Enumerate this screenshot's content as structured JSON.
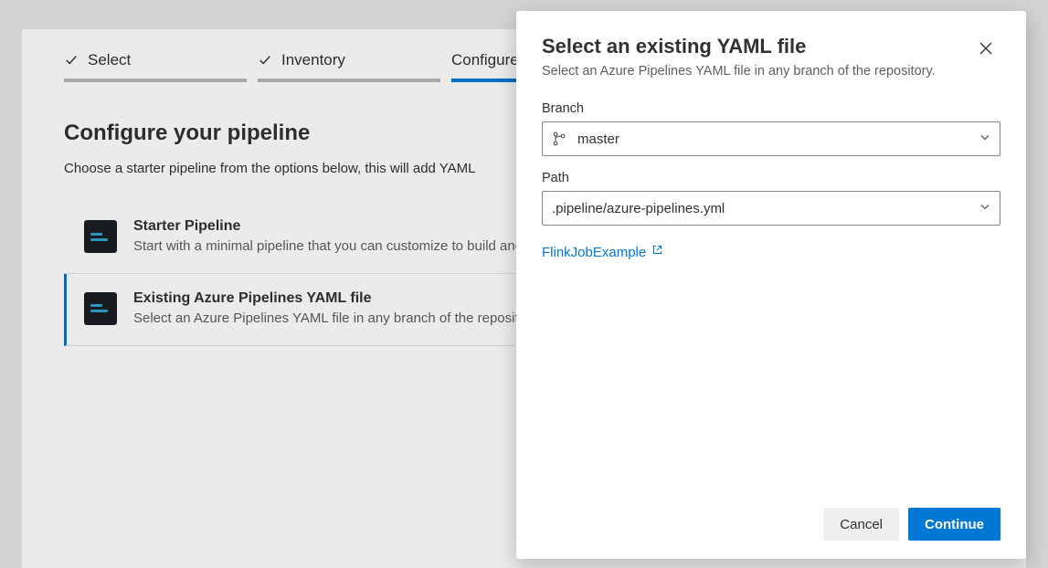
{
  "wizard": {
    "steps": [
      {
        "label": "Select",
        "done": true
      },
      {
        "label": "Inventory",
        "done": true
      },
      {
        "label": "Configure",
        "done": false,
        "active": true
      }
    ]
  },
  "page": {
    "heading": "Configure your pipeline",
    "subtext": "Choose a starter pipeline from the options below, this will add YAML"
  },
  "options": [
    {
      "title": "Starter Pipeline",
      "desc": "Start with a minimal pipeline that you can customize to build and deploy your code."
    },
    {
      "title": "Existing Azure Pipelines YAML file",
      "desc": "Select an Azure Pipelines YAML file in any branch of the repository."
    }
  ],
  "dialog": {
    "title": "Select an existing YAML file",
    "subtitle": "Select an Azure Pipelines YAML file in any branch of the repository.",
    "branch_label": "Branch",
    "branch_value": "master",
    "path_label": "Path",
    "path_value": ".pipeline/azure-pipelines.yml",
    "repo_link": "FlinkJobExample",
    "cancel_label": "Cancel",
    "continue_label": "Continue"
  }
}
